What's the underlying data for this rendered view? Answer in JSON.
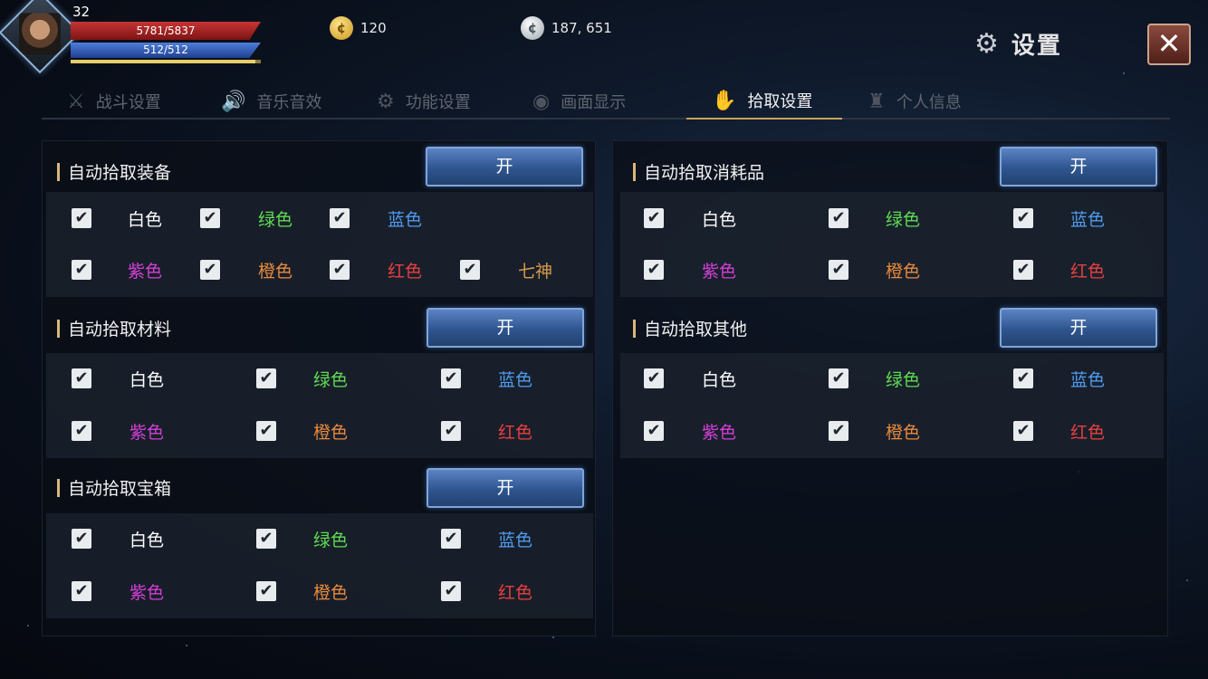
{
  "player": {
    "level": "32",
    "hp": "5781/5837",
    "mp": "512/512",
    "exp_fraction": 0.97
  },
  "currency": {
    "gold": "120",
    "silver": "187, 651"
  },
  "header": {
    "title": "设置",
    "close": "✕"
  },
  "tabs": [
    {
      "label": "战斗设置",
      "icon": "crossed-swords-icon"
    },
    {
      "label": "音乐音效",
      "icon": "speaker-icon"
    },
    {
      "label": "功能设置",
      "icon": "gear-icon"
    },
    {
      "label": "画面显示",
      "icon": "eye-icon"
    },
    {
      "label": "拾取设置",
      "icon": "pickup-icon",
      "active": true
    },
    {
      "label": "个人信息",
      "icon": "helmet-icon"
    }
  ],
  "colors": {
    "white": "#ffffff",
    "green": "#5fdc52",
    "blue": "#4f9cf0",
    "purple": "#d43fd8",
    "orange": "#e88a3c",
    "red": "#e84040",
    "seven": "#d99a4a"
  },
  "toggle_label": "开",
  "sections": {
    "equipment": {
      "title": "自动拾取装备",
      "toggle": "开",
      "options": [
        "白色",
        "绿色",
        "蓝色",
        "紫色",
        "橙色",
        "红色",
        "七神"
      ]
    },
    "material": {
      "title": "自动拾取材料",
      "toggle": "开",
      "options": [
        "白色",
        "绿色",
        "蓝色",
        "紫色",
        "橙色",
        "红色"
      ]
    },
    "chest": {
      "title": "自动拾取宝箱",
      "toggle": "开",
      "options": [
        "白色",
        "绿色",
        "蓝色",
        "紫色",
        "橙色",
        "红色"
      ]
    },
    "consumable": {
      "title": "自动拾取消耗品",
      "toggle": "开",
      "options": [
        "白色",
        "绿色",
        "蓝色",
        "紫色",
        "橙色",
        "红色"
      ]
    },
    "other": {
      "title": "自动拾取其他",
      "toggle": "开",
      "options": [
        "白色",
        "绿色",
        "蓝色",
        "紫色",
        "橙色",
        "红色"
      ]
    }
  }
}
